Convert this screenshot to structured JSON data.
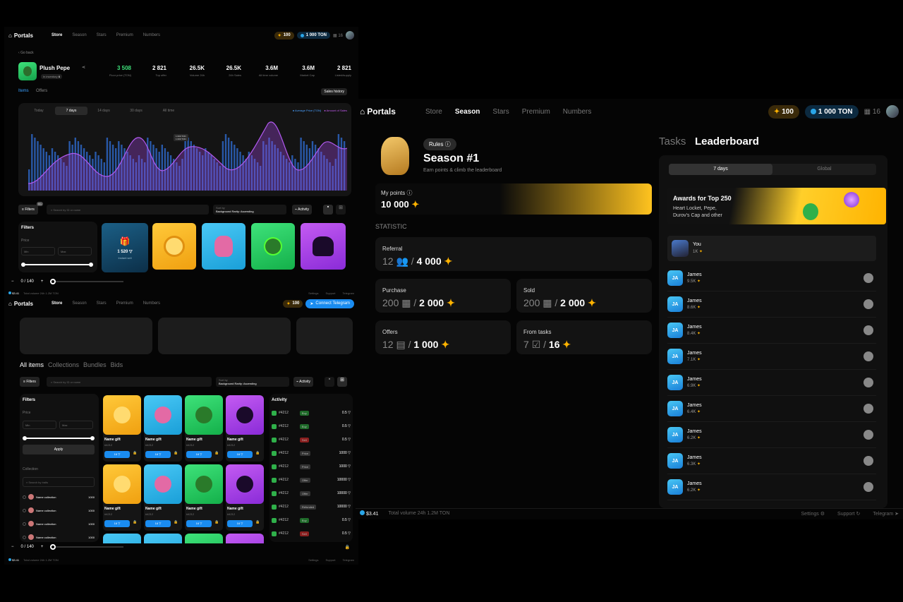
{
  "brand": "Portals",
  "nav": [
    "Store",
    "Season",
    "Stars",
    "Premium",
    "Numbers"
  ],
  "stars_balance": "100",
  "ton_balance": "1 000 TON",
  "gift_count": "16",
  "connect_label": "Connect Telegram",
  "panel1": {
    "back": "Go back",
    "collection_name": "Plush Pepe",
    "in_inventory": "In inventory",
    "inventory_count": "6",
    "stats": [
      {
        "value": "3 508",
        "label": "Floor price (TON)"
      },
      {
        "value": "2 821",
        "label": "Top offer"
      },
      {
        "value": "26.5K",
        "label": "Volume 24h"
      },
      {
        "value": "26.5K",
        "label": "24h Sales"
      },
      {
        "value": "3.6M",
        "label": "All time volume"
      },
      {
        "value": "3.6M",
        "label": "Market Cap"
      },
      {
        "value": "2 821",
        "label": "Listed/supply"
      }
    ],
    "tabs": [
      "Items",
      "Offers"
    ],
    "sales_history": "Sales history",
    "ranges": [
      "Today",
      "7 days",
      "14 days",
      "30 days",
      "All time"
    ],
    "legend": [
      "Average Price (TON)",
      "Amount of Sales"
    ],
    "tooltip": [
      "1 000 TON",
      "1 000 TON"
    ],
    "filters_label": "Filters",
    "filters_badge": "10+",
    "search_placeholder": "Search by ID or name",
    "sort_label": "Sort by",
    "sort_value": "Background Rarity: Ascending",
    "activity": "Activity",
    "filters_title": "Filters",
    "price_label": "Price",
    "min": "Min",
    "max": "Max",
    "instant_price": "1 520",
    "instant_sell": "Instant sell",
    "page": "0 / 140",
    "footer": {
      "price": "$3.41",
      "volume": "Total volume 24h  1.2M TON",
      "settings": "Settings",
      "support": "Support",
      "telegram": "Telegram"
    }
  },
  "panel2": {
    "tabs": [
      "All items",
      "Collections",
      "Bundles",
      "Bids"
    ],
    "filters_label": "Filters",
    "search_placeholder": "Search by ID or name",
    "sort_label": "Sort by",
    "sort_value": "Background Rarity: Ascending",
    "activity": "Activity",
    "filters_title": "Filters",
    "price_label": "Price",
    "min": "Min",
    "max": "Max",
    "apply": "Apply",
    "collection": "Collection",
    "search_traits": "Search by traits",
    "collections": [
      {
        "name": "Name collection",
        "value": "1000"
      },
      {
        "name": "Name collection",
        "value": "1000"
      },
      {
        "name": "Name collection",
        "value": "1000"
      },
      {
        "name": "Name collection",
        "value": "1000"
      }
    ],
    "gift_name": "Name gift",
    "gift_id": "#4212",
    "gift_price": "16",
    "activity_title": "Activity",
    "activity_rows": [
      {
        "id": "#4212",
        "tag": "Buy",
        "val": "0.5"
      },
      {
        "id": "#4212",
        "tag": "Buy",
        "val": "0.5"
      },
      {
        "id": "#4212",
        "tag": "Sell",
        "val": "0.5"
      },
      {
        "id": "#4212",
        "tag": "Price",
        "val": "1000"
      },
      {
        "id": "#4212",
        "tag": "Price",
        "val": "1000"
      },
      {
        "id": "#4212",
        "tag": "Offer",
        "val": "10000"
      },
      {
        "id": "#4212",
        "tag": "Offer",
        "val": "10000"
      },
      {
        "id": "#4212",
        "tag": "Refunded",
        "val": "10000"
      },
      {
        "id": "#4212",
        "tag": "Buy",
        "val": "0.5"
      },
      {
        "id": "#4212",
        "tag": "Sell",
        "val": "0.5"
      }
    ],
    "page": "0 / 140",
    "footer": {
      "price": "$3.41",
      "volume": "Total volume 24h  1.2M TON",
      "settings": "Settings",
      "support": "Support",
      "telegram": "Telegram"
    }
  },
  "panel3": {
    "rules": "Rules",
    "season_title": "Season #1",
    "season_sub": "Earn points & climb the leaderboard",
    "my_points_label": "My points",
    "my_points": "10 000",
    "statistic": "STATISTIC",
    "referral_label": "Referral",
    "referral_dim": "12",
    "referral_val": "4 000",
    "purchase_label": "Purchase",
    "purchase_dim": "200",
    "purchase_val": "2 000",
    "sold_label": "Sold",
    "sold_dim": "200",
    "sold_val": "2 000",
    "offers_label": "Offers",
    "offers_dim": "12",
    "offers_val": "1 000",
    "tasks_label": "From tasks",
    "tasks_dim": "7",
    "tasks_val": "16",
    "tabs": [
      "Tasks",
      "Leaderboard"
    ],
    "lb_ranges": [
      "7 days",
      "Global"
    ],
    "award_title": "Awards for Top 250",
    "award_sub1": "Heart Locket, Pepe,",
    "award_sub2": "Durov's Cap and other",
    "you_label": "You",
    "you_score": "1K",
    "leaders": [
      {
        "name": "James",
        "score": "9.5K"
      },
      {
        "name": "James",
        "score": "8.6K"
      },
      {
        "name": "James",
        "score": "8.4K"
      },
      {
        "name": "James",
        "score": "7.1K"
      },
      {
        "name": "James",
        "score": "6.9K"
      },
      {
        "name": "James",
        "score": "6.4K"
      },
      {
        "name": "James",
        "score": "6.2K"
      },
      {
        "name": "James",
        "score": "6.3K"
      },
      {
        "name": "James",
        "score": "6.2K"
      }
    ],
    "initials": "JA",
    "footer": {
      "price": "$3.41",
      "volume": "Total volume 24h  1.2M TON",
      "settings": "Settings",
      "support": "Support",
      "telegram": "Telegram"
    }
  },
  "colors": {
    "accent": "#1a8cf0",
    "gold": "#ffb300",
    "green": "#3ee27a",
    "purple": "#c45bf2"
  }
}
